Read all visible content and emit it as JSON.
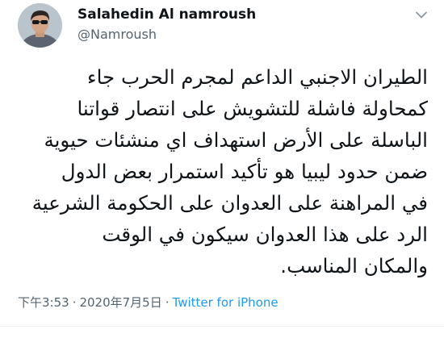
{
  "tweet": {
    "author_name": "Salahedin Al namroush",
    "author_handle": "@Namroush",
    "text": "الطيران الاجنبي الداعم لمجرم الحرب جاء\nكمحاولة فاشلة للتشويش على انتصار قواتنا\nالباسلة على الأرض استهداف اي منشئات حيوية\nضمن حدود ليبيا هو تأكيد استمرار بعض الدول\nفي المراهنة على العدوان على الحكومة الشرعية\nالرد  على هذا العدوان سيكون في الوقت\nوالمكان المناسب.",
    "time": "下午3:53",
    "separator": "·",
    "date": "2020年7月5日",
    "source": "Twitter for iPhone"
  },
  "icons": {
    "avatar": "avatar-photo",
    "menu": "chevron-down-icon"
  },
  "colors": {
    "text_primary": "#0f1419",
    "text_secondary": "#536471",
    "link": "#1d9bf0"
  }
}
